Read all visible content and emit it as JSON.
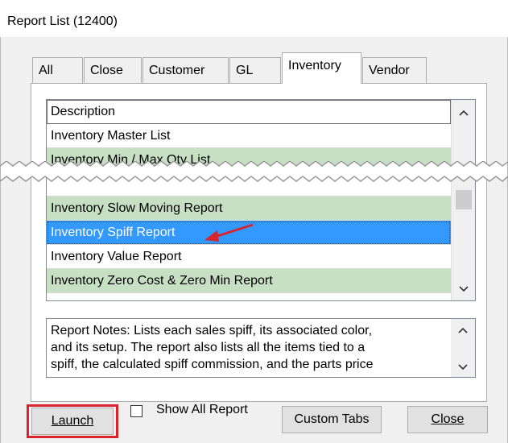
{
  "window": {
    "title": "Report List (12400)"
  },
  "tabs": [
    {
      "label": "All"
    },
    {
      "label": "Close"
    },
    {
      "label": "Customer"
    },
    {
      "label": "GL"
    },
    {
      "label": "Inventory"
    },
    {
      "label": "Vendor"
    }
  ],
  "active_tab": "Inventory",
  "list": {
    "header": "Description",
    "rows": [
      {
        "label": "Inventory Master List"
      },
      {
        "label": "Inventory Min / Max Qty List"
      },
      {
        "label": "Inventory Slow Moving Report"
      },
      {
        "label": "Inventory Spiff Report"
      },
      {
        "label": "Inventory Value Report"
      },
      {
        "label": "Inventory Zero Cost & Zero Min Report"
      }
    ],
    "selected": "Inventory Spiff Report"
  },
  "notes": {
    "line1": "Report Notes:  Lists each sales spiff, its associated color,",
    "line2": "and its setup. The report also lists all the items tied to a",
    "line3": "spiff, the calculated spiff commission, and the parts price"
  },
  "buttons": {
    "launch": "Launch",
    "show_all": "Show All Report",
    "custom_tabs": "Custom Tabs",
    "close": "Close"
  },
  "colors": {
    "selected_row": "#3399ff",
    "green_row": "#c7e0c4",
    "highlight": "#d9232d"
  },
  "icons": [
    "scroll-up-icon",
    "scroll-down-icon",
    "red-arrow-icon"
  ]
}
